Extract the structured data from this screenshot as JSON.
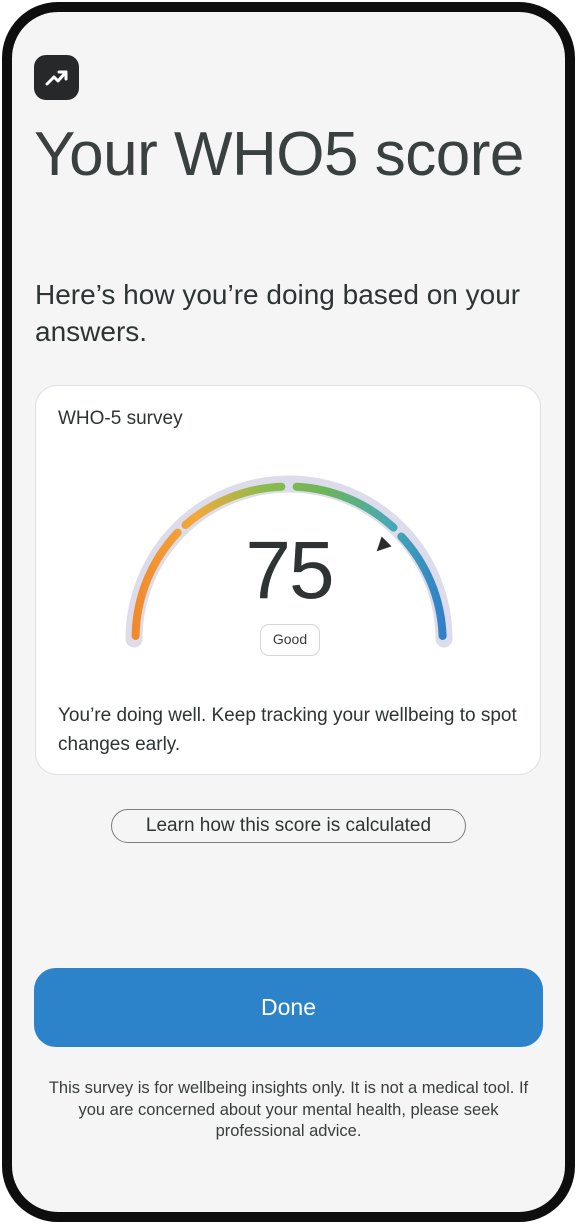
{
  "header": {
    "icon": "trending-up-icon",
    "title": "Your WHO5 score",
    "subtitle": "Here’s how you’re doing based on your answers."
  },
  "card": {
    "title": "WHO-5 survey",
    "score": "75",
    "score_fraction": 0.75,
    "rating": "Good",
    "description": "You’re doing well. Keep tracking your wellbeing to spot changes early.",
    "gauge_colors": [
      "#f08a2c",
      "#f2a93a",
      "#8cbc4c",
      "#6cb45a",
      "#48aab2",
      "#2f80c8"
    ],
    "track_color": "#dcdcea",
    "pointer_color": "#2b2b2b"
  },
  "learn_link": {
    "label": "Learn how this score is calculated"
  },
  "done_button": {
    "label": "Done",
    "color": "#2c83c9"
  },
  "disclaimer": "This survey is for wellbeing insights only. It is not a medical tool. If you are concerned about your mental health, please seek professional advice."
}
